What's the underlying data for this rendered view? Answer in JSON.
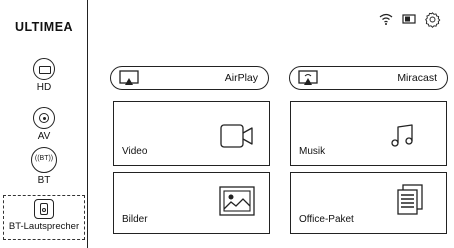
{
  "sidebar": {
    "brand": "ULTIMEA",
    "sources": [
      {
        "label": "HD",
        "icon": "hdmi-icon"
      },
      {
        "label": "AV",
        "icon": "av-icon"
      },
      {
        "label": "BT",
        "icon": "bluetooth-icon",
        "badge": "((BT))"
      },
      {
        "label": "BT-Lautsprecher",
        "icon": "speaker-icon",
        "selected": true
      }
    ]
  },
  "status_bar": {
    "icons": [
      "wifi-icon",
      "card-icon",
      "settings-icon"
    ]
  },
  "cast": {
    "airplay_label": "AirPlay",
    "miracast_label": "Miracast"
  },
  "tiles": {
    "video": "Video",
    "music": "Musik",
    "pictures": "Bilder",
    "office": "Office-Paket"
  }
}
